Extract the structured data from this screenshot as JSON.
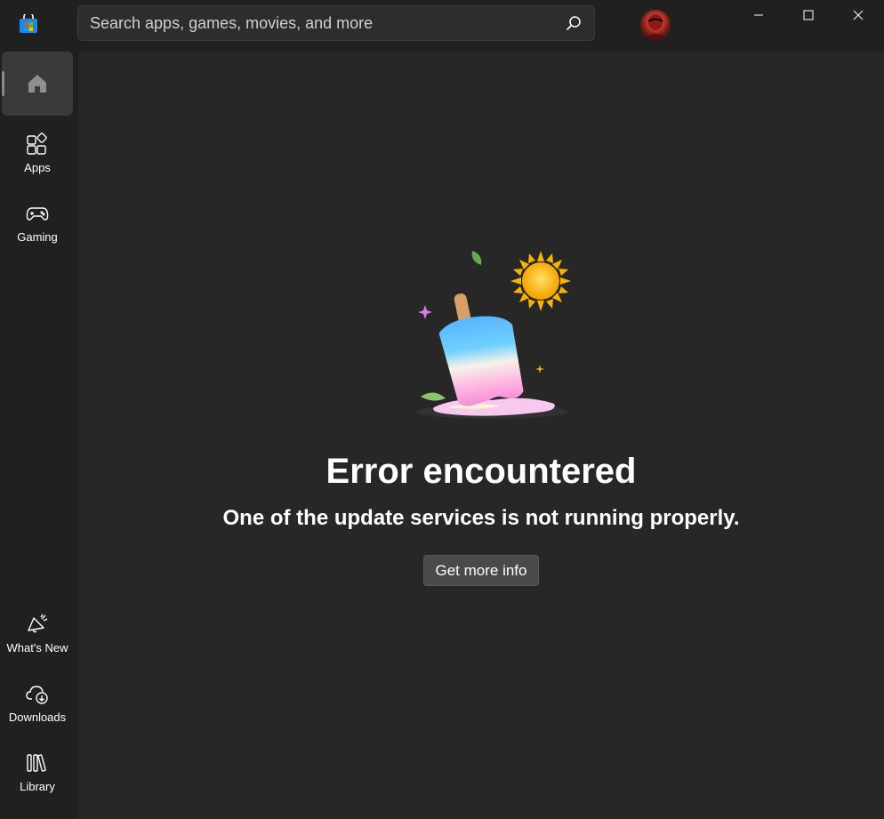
{
  "search": {
    "placeholder": "Search apps, games, movies, and more"
  },
  "window_controls": [
    "minimize",
    "maximize",
    "close"
  ],
  "sidebar": {
    "items": [
      {
        "label": "",
        "icon": "home-icon",
        "active": true
      },
      {
        "label": "Apps",
        "icon": "apps-icon"
      },
      {
        "label": "Gaming",
        "icon": "gamepad-icon"
      },
      {
        "label": "What's New",
        "icon": "megaphone-icon"
      },
      {
        "label": "Downloads",
        "icon": "cloud-download-icon"
      },
      {
        "label": "Library",
        "icon": "library-icon"
      }
    ]
  },
  "main": {
    "title": "Error encountered",
    "message": "One of the update services is not running properly.",
    "button_label": "Get more info"
  },
  "colors": {
    "background": "#202020",
    "panel": "#272727",
    "button": "#4a4a4a"
  }
}
